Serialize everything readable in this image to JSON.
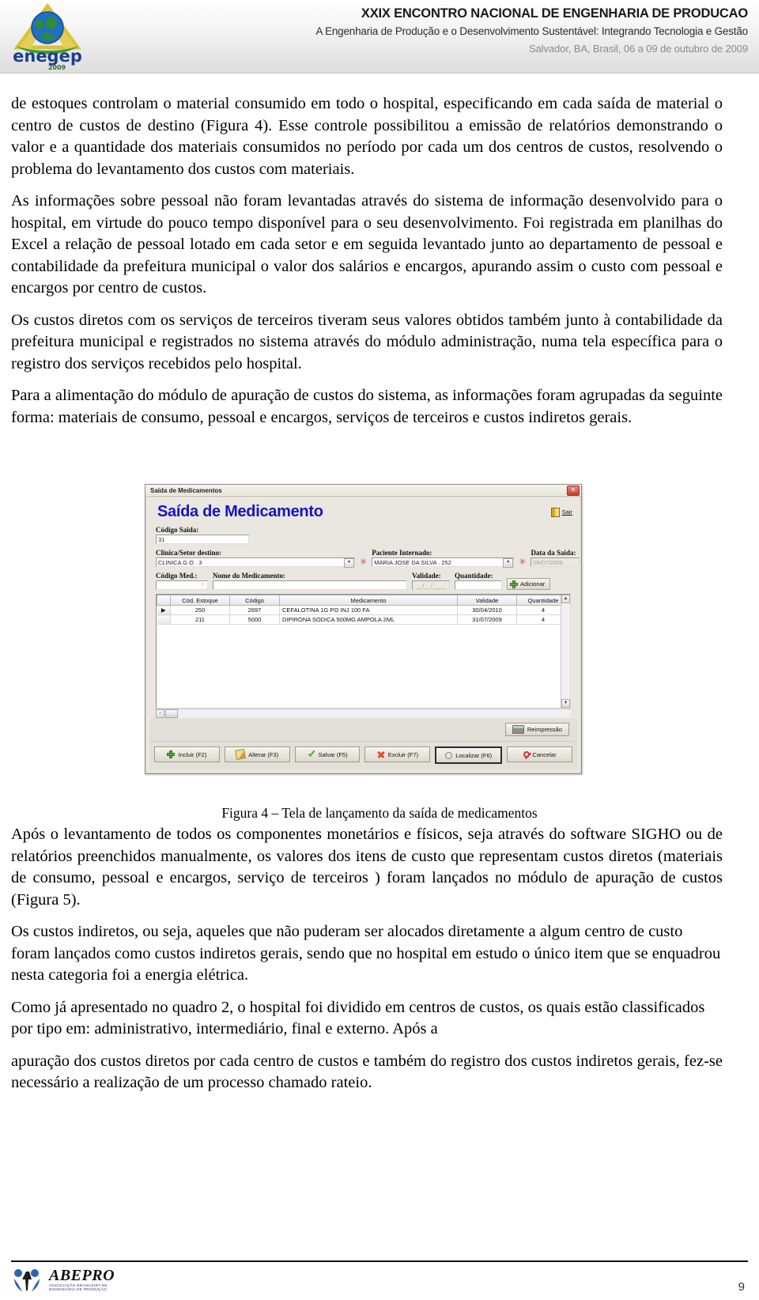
{
  "header": {
    "conference_title": "XXIX ENCONTRO NACIONAL DE ENGENHARIA DE PRODUCAO",
    "theme": "A Engenharia de Produção e o Desenvolvimento Sustentável:  Integrando Tecnologia e Gestão",
    "location_date": "Salvador, BA, Brasil,  06 a 09 de outubro de 2009",
    "logo_text": "enegep",
    "logo_year": "2009"
  },
  "paragraphs": {
    "p1": "de estoques controlam o material consumido em todo o hospital, especificando em cada saída de material o centro de custos de destino (Figura 4). Esse controle possibilitou a emissão de relatórios demonstrando o valor e a quantidade dos materiais consumidos no período por cada um dos centros de custos, resolvendo o problema do levantamento dos custos com materiais.",
    "p2": "As informações sobre pessoal não foram levantadas através do sistema de informação desenvolvido para o hospital, em virtude do pouco tempo disponível para o seu desenvolvimento. Foi registrada em planilhas do Excel a relação de pessoal lotado em cada setor e em seguida levantado junto ao departamento de pessoal e contabilidade da prefeitura municipal o valor dos salários e encargos, apurando assim o custo com pessoal e encargos por centro de custos.",
    "p3": "Os custos diretos com os serviços de terceiros tiveram seus valores obtidos também junto à contabilidade da prefeitura municipal e registrados no sistema através do módulo administração, numa tela específica para o registro dos serviços recebidos pelo hospital.",
    "p4": "Para a alimentação do módulo de apuração de custos do sistema, as informações foram agrupadas da seguinte forma: materiais de consumo, pessoal e encargos, serviços de terceiros e custos indiretos gerais.",
    "p5": "Após o levantamento de todos os componentes monetários e físicos, seja através do software SIGHO ou de relatórios preenchidos manualmente, os valores dos itens de custo que representam custos diretos (materiais de consumo, pessoal e encargos, serviço de terceiros ) foram lançados no módulo de apuração de custos (Figura 5).",
    "p6": "Os custos indiretos, ou seja, aqueles que não puderam ser alocados diretamente a algum centro de custo foram lançados como custos indiretos gerais, sendo que no hospital em estudo o único item que se enquadrou nesta categoria foi a energia elétrica.",
    "p7": "Como já apresentado no quadro 2, o hospital foi dividido em centros de custos, os quais estão classificados por tipo em: administrativo, intermediário, final e externo. Após a",
    "p8": "apuração dos custos diretos por cada centro de custos e também do registro dos custos indiretos gerais, fez-se necessário a realização de um processo chamado rateio."
  },
  "figure": {
    "caption": "Figura 4 – Tela de lançamento da saída de medicamentos",
    "window_title": "Saída de Medicamentos",
    "close_glyph": "✕",
    "form_title": "Saída de Medicamento",
    "exit_button": "Sair",
    "fields": {
      "codigo_saida_label": "Código Saida:",
      "codigo_saida_value": "31",
      "clinica_label": "Clinica/Setor destino:",
      "clinica_value": "CLINICA G O . 3",
      "paciente_label": "Paciente Internado:",
      "paciente_value": "MARIA JOSE DA SILVA . 252",
      "data_saida_label": "Data da Saida:",
      "data_saida_value": "09/07/2009",
      "codigo_med_label": "Código Med.:",
      "codigo_med_value": "",
      "nome_med_label": "Nome do Medicamento:",
      "nome_med_value": "",
      "validade_label": "Validade:",
      "validade_value": "__/__/____",
      "quantidade_label": "Quantidade:",
      "quantidade_value": "",
      "adicionar_button": "Adicionar"
    },
    "grid": {
      "columns": [
        "",
        "Cód. Estoque",
        "Código",
        "Medicamento",
        "Validade",
        "Quantidade"
      ],
      "rows": [
        {
          "marker": "▶",
          "cod_estoque": "250",
          "codigo": "2697",
          "medicamento": "CEFALOTINA 1G PO INJ 100 FA",
          "validade": "30/04/2010",
          "quantidade": "4"
        },
        {
          "marker": "",
          "cod_estoque": "211",
          "codigo": "5000",
          "medicamento": "DIPIRONA SODICA 500MG AMPOLA 2ML",
          "validade": "31/07/2009",
          "quantidade": "4"
        }
      ]
    },
    "reimpressao_button": "Reimpressão",
    "action_buttons": [
      {
        "label": "Incluir (F2)",
        "icon": "plus-icon"
      },
      {
        "label": "Alterar (F3)",
        "icon": "pencil-icon"
      },
      {
        "label": "Salvar (F5)",
        "icon": "check-icon"
      },
      {
        "label": "Excluir (F7)",
        "icon": "x-icon"
      },
      {
        "label": "Localizar (F6)",
        "icon": "magnifier-icon"
      },
      {
        "label": "Cancelar",
        "icon": "ban-icon"
      }
    ],
    "scroll_left_glyph": "‹",
    "scroll_up_glyph": "▲",
    "scroll_down_glyph": "▼",
    "combo_arrow_glyph": "▾",
    "required_glyph": "✳"
  },
  "footer": {
    "org_name": "ABEPRO",
    "org_sub_line1": "ASSOCIAÇÃO BRASILEIRA DE",
    "org_sub_line2": "ENGENHARIA DE PRODUÇÃO",
    "page_number": "9"
  }
}
